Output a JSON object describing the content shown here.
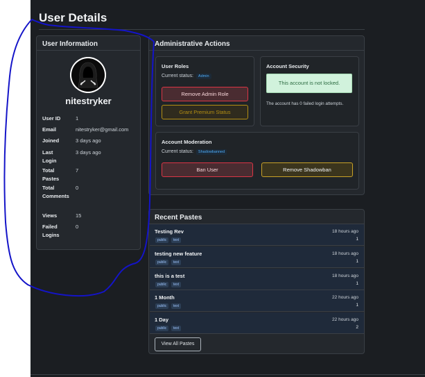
{
  "page": {
    "title": "User Details"
  },
  "user_info": {
    "heading": "User Information",
    "username": "nitestryker",
    "fields": [
      {
        "key": "User ID",
        "value": "1"
      },
      {
        "key": "Email",
        "value": "nitestryker@gmail.com"
      },
      {
        "key": "Joined",
        "value": "3 days ago"
      },
      {
        "key": "Last Login",
        "value": "3 days ago"
      },
      {
        "key": "Total Pastes",
        "value": "7"
      },
      {
        "key": "Total Comments",
        "value": "0"
      },
      {
        "key": "Views",
        "value": "15"
      },
      {
        "key": "Failed Logins",
        "value": "0"
      }
    ]
  },
  "admin": {
    "heading": "Administrative Actions",
    "roles": {
      "title": "User Roles",
      "status_label": "Current status:",
      "status_value": "Admin",
      "remove_admin": "Remove Admin Role",
      "grant_premium": "Grant Premium Status"
    },
    "security": {
      "title": "Account Security",
      "alert": "This account is not locked.",
      "note": "The account has 0 failed login attempts."
    },
    "moderation": {
      "title": "Account Moderation",
      "status_label": "Current status:",
      "status_value": "Shadowbanned",
      "ban": "Ban User",
      "remove_shadowban": "Remove Shadowban"
    }
  },
  "pastes": {
    "heading": "Recent Pastes",
    "items": [
      {
        "title": "Testing Rev",
        "time": "18 hours ago",
        "count": "1",
        "tags": [
          "public",
          "text"
        ]
      },
      {
        "title": "testing new feature",
        "time": "18 hours ago",
        "count": "1",
        "tags": [
          "public",
          "text"
        ]
      },
      {
        "title": "this is a test",
        "time": "18 hours ago",
        "count": "1",
        "tags": [
          "public",
          "text"
        ]
      },
      {
        "title": "1 Month",
        "time": "22 hours ago",
        "count": "1",
        "tags": [
          "public",
          "text"
        ]
      },
      {
        "title": "1 Day",
        "time": "22 hours ago",
        "count": "2",
        "tags": [
          "public",
          "text"
        ]
      }
    ],
    "view_all": "View All Pastes"
  },
  "colors": {
    "background": "#1b1e22",
    "card": "#24282d",
    "danger": "#dc3545",
    "warning": "#b48f13",
    "annotation": "#1414c8"
  }
}
